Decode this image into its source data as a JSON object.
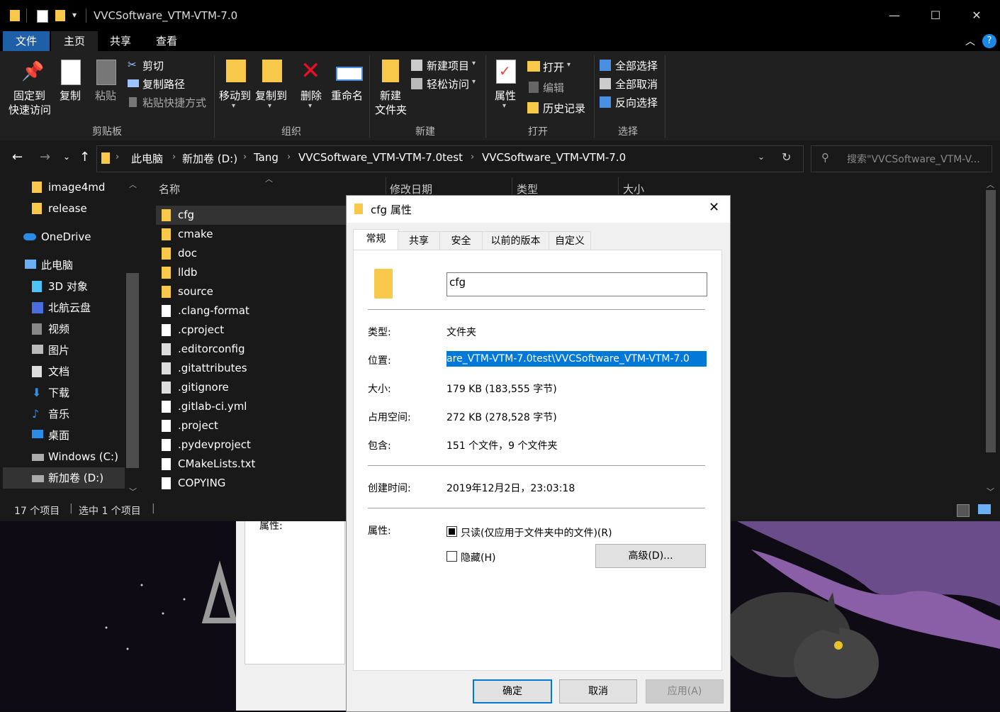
{
  "window": {
    "title": "VVCSoftware_VTM-VTM-7.0",
    "minimize": "—",
    "maximize": "☐",
    "close": "✕"
  },
  "ribbon_tabs": {
    "file": "文件",
    "home": "主页",
    "share": "共享",
    "view": "查看"
  },
  "ribbon": {
    "pin_line1": "固定到",
    "pin_line2": "快速访问",
    "copy": "复制",
    "paste": "粘贴",
    "cut": "剪切",
    "copy_path": "复制路径",
    "paste_shortcut": "粘贴快捷方式",
    "group_clipboard": "剪贴板",
    "move_to": "移动到",
    "copy_to": "复制到",
    "delete": "删除",
    "rename": "重命名",
    "group_organize": "组织",
    "new_folder_line1": "新建",
    "new_folder_line2": "文件夹",
    "new_item": "新建项目",
    "easy_access": "轻松访问",
    "group_new": "新建",
    "properties": "属性",
    "open": "打开",
    "edit": "编辑",
    "history": "历史记录",
    "group_open": "打开",
    "select_all": "全部选择",
    "select_none": "全部取消",
    "invert_selection": "反向选择",
    "group_select": "选择"
  },
  "address": {
    "crumbs": [
      "此电脑",
      "新加卷 (D:)",
      "Tang",
      "VVCSoftware_VTM-VTM-7.0test",
      "VVCSoftware_VTM-VTM-7.0"
    ],
    "search_placeholder": "搜索\"VVCSoftware_VTM-V..."
  },
  "nav": {
    "items": [
      "image4md",
      "release",
      "OneDrive",
      "此电脑",
      "3D 对象",
      "北航云盘",
      "视频",
      "图片",
      "文档",
      "下载",
      "音乐",
      "桌面",
      "Windows (C:)",
      "新加卷 (D:)"
    ]
  },
  "columns": {
    "name": "名称",
    "modified": "修改日期",
    "type": "类型",
    "size": "大小"
  },
  "files": [
    "cfg",
    "cmake",
    "doc",
    "lldb",
    "source",
    ".clang-format",
    ".cproject",
    ".editorconfig",
    ".gitattributes",
    ".gitignore",
    ".gitlab-ci.yml",
    ".project",
    ".pydevproject",
    "CMakeLists.txt",
    "COPYING"
  ],
  "status": {
    "count": "17 个项目",
    "selected": "选中 1 个项目"
  },
  "dialog": {
    "title": "cfg 属性",
    "tabs": [
      "常规",
      "共享",
      "安全",
      "以前的版本",
      "自定义"
    ],
    "name_value": "cfg",
    "type_label": "类型:",
    "type_value": "文件夹",
    "location_label": "位置:",
    "location_value": "are_VTM-VTM-7.0test\\VVCSoftware_VTM-VTM-7.0",
    "size_label": "大小:",
    "size_value": "179 KB (183,555 字节)",
    "disk_label": "占用空间:",
    "disk_value": "272 KB (278,528 字节)",
    "contains_label": "包含:",
    "contains_value": "151 个文件，9 个文件夹",
    "created_label": "创建时间:",
    "created_value": "2019年12月2日，23:03:18",
    "attr_label": "属性:",
    "readonly": "只读(仅应用于文件夹中的文件)(R)",
    "hidden": "隐藏(H)",
    "advanced": "高级(D)...",
    "ok": "确定",
    "cancel": "取消",
    "apply": "应用(A)"
  },
  "background_dialog": {
    "attr_label": "属性:"
  },
  "colors": {
    "accent": "#0078d7",
    "folder": "#f8c84a",
    "dark_bg": "#191919"
  }
}
